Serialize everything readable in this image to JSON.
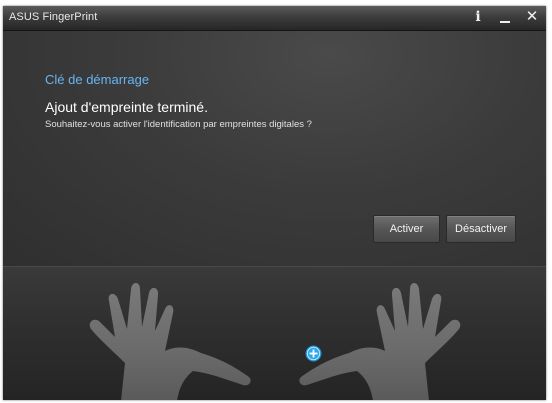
{
  "window": {
    "title": "ASUS FingerPrint",
    "info_glyph": "i",
    "close_glyph": "✕"
  },
  "content": {
    "step_title": "Clé de démarrage",
    "heading": "Ajout d'empreinte terminé.",
    "question": "Souhaitez-vous activer l'identification par empreintes digitales ?"
  },
  "actions": {
    "activate_label": "Activer",
    "deactivate_label": "Désactiver"
  },
  "hands": {
    "left_icon": "left-hand-icon",
    "right_icon": "right-hand-icon",
    "add_icon": "add-finger-icon"
  },
  "colors": {
    "accent": "#69b4f2",
    "marker": "#2aa8e8"
  }
}
